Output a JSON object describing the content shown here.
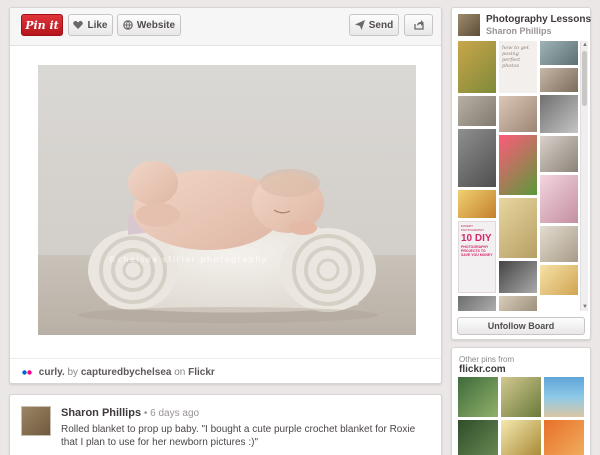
{
  "toolbar": {
    "pinit_label": "Pin it",
    "like_label": "Like",
    "website_label": "Website",
    "send_label": "Send"
  },
  "pin": {
    "watermark": "©chelsea stirler photography",
    "source": {
      "title": "curly.",
      "by": "by",
      "user": "capturedbychelsea",
      "on": "on",
      "site": "Flickr"
    }
  },
  "comment": {
    "author": "Sharon Phillips",
    "time": "• 6 days ago",
    "text": "Rolled blanket to prop up baby. \"I bought a cute purple crochet blanket for Roxie that I plan to use for her newborn pictures :)\""
  },
  "board": {
    "title": "Photography Lessons",
    "owner": "Sharon Phillips",
    "unfollow_label": "Unfollow Board",
    "tile_text": {
      "posing": "how to get posing perfect photos",
      "diy_header": "EXPERT PHOTOGRAPHY",
      "diy_big": "10 DIY",
      "diy_sub": "PHOTOGRAPHY PROJECTS TO SAVE YOU MONEY"
    }
  },
  "other_pins": {
    "label": "Other pins from",
    "source": "flickr.com"
  },
  "icons": {
    "like": "heart-icon",
    "website": "globe-icon",
    "send": "paper-plane-icon",
    "share": "share-arrow-icon",
    "source": "flickr-icon"
  },
  "colors": {
    "pinit_red": "#cb2027",
    "background": "#ebe7e7",
    "flickr_blue": "#0063dc",
    "flickr_pink": "#ff0084"
  }
}
